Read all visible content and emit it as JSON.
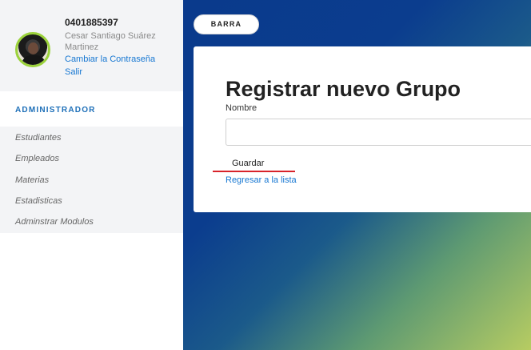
{
  "user": {
    "id": "0401885397",
    "name": "Cesar Santiago Suárez Martinez",
    "change_password": "Cambiar la Contraseña",
    "logout": "Salir"
  },
  "sidebar": {
    "section_title": "ADMINISTRADOR",
    "items": [
      {
        "label": "Estudiantes"
      },
      {
        "label": "Empleados"
      },
      {
        "label": "Materias"
      },
      {
        "label": "Estadisticas"
      },
      {
        "label": "Adminstrar Modulos"
      }
    ]
  },
  "header": {
    "barra_button": "BARRA"
  },
  "form": {
    "title": "Registrar nuevo Grupo",
    "field_label": "Nombre",
    "field_value": "",
    "field_placeholder": "",
    "submit_label": "Guardar",
    "back_link": "Regresar a la lista"
  },
  "colors": {
    "link": "#1677d2",
    "accent_underline": "#d8232a",
    "avatar_ring": "#9bd23b",
    "gradient_start": "#0a3a8c",
    "gradient_end": "#b7cc62"
  }
}
